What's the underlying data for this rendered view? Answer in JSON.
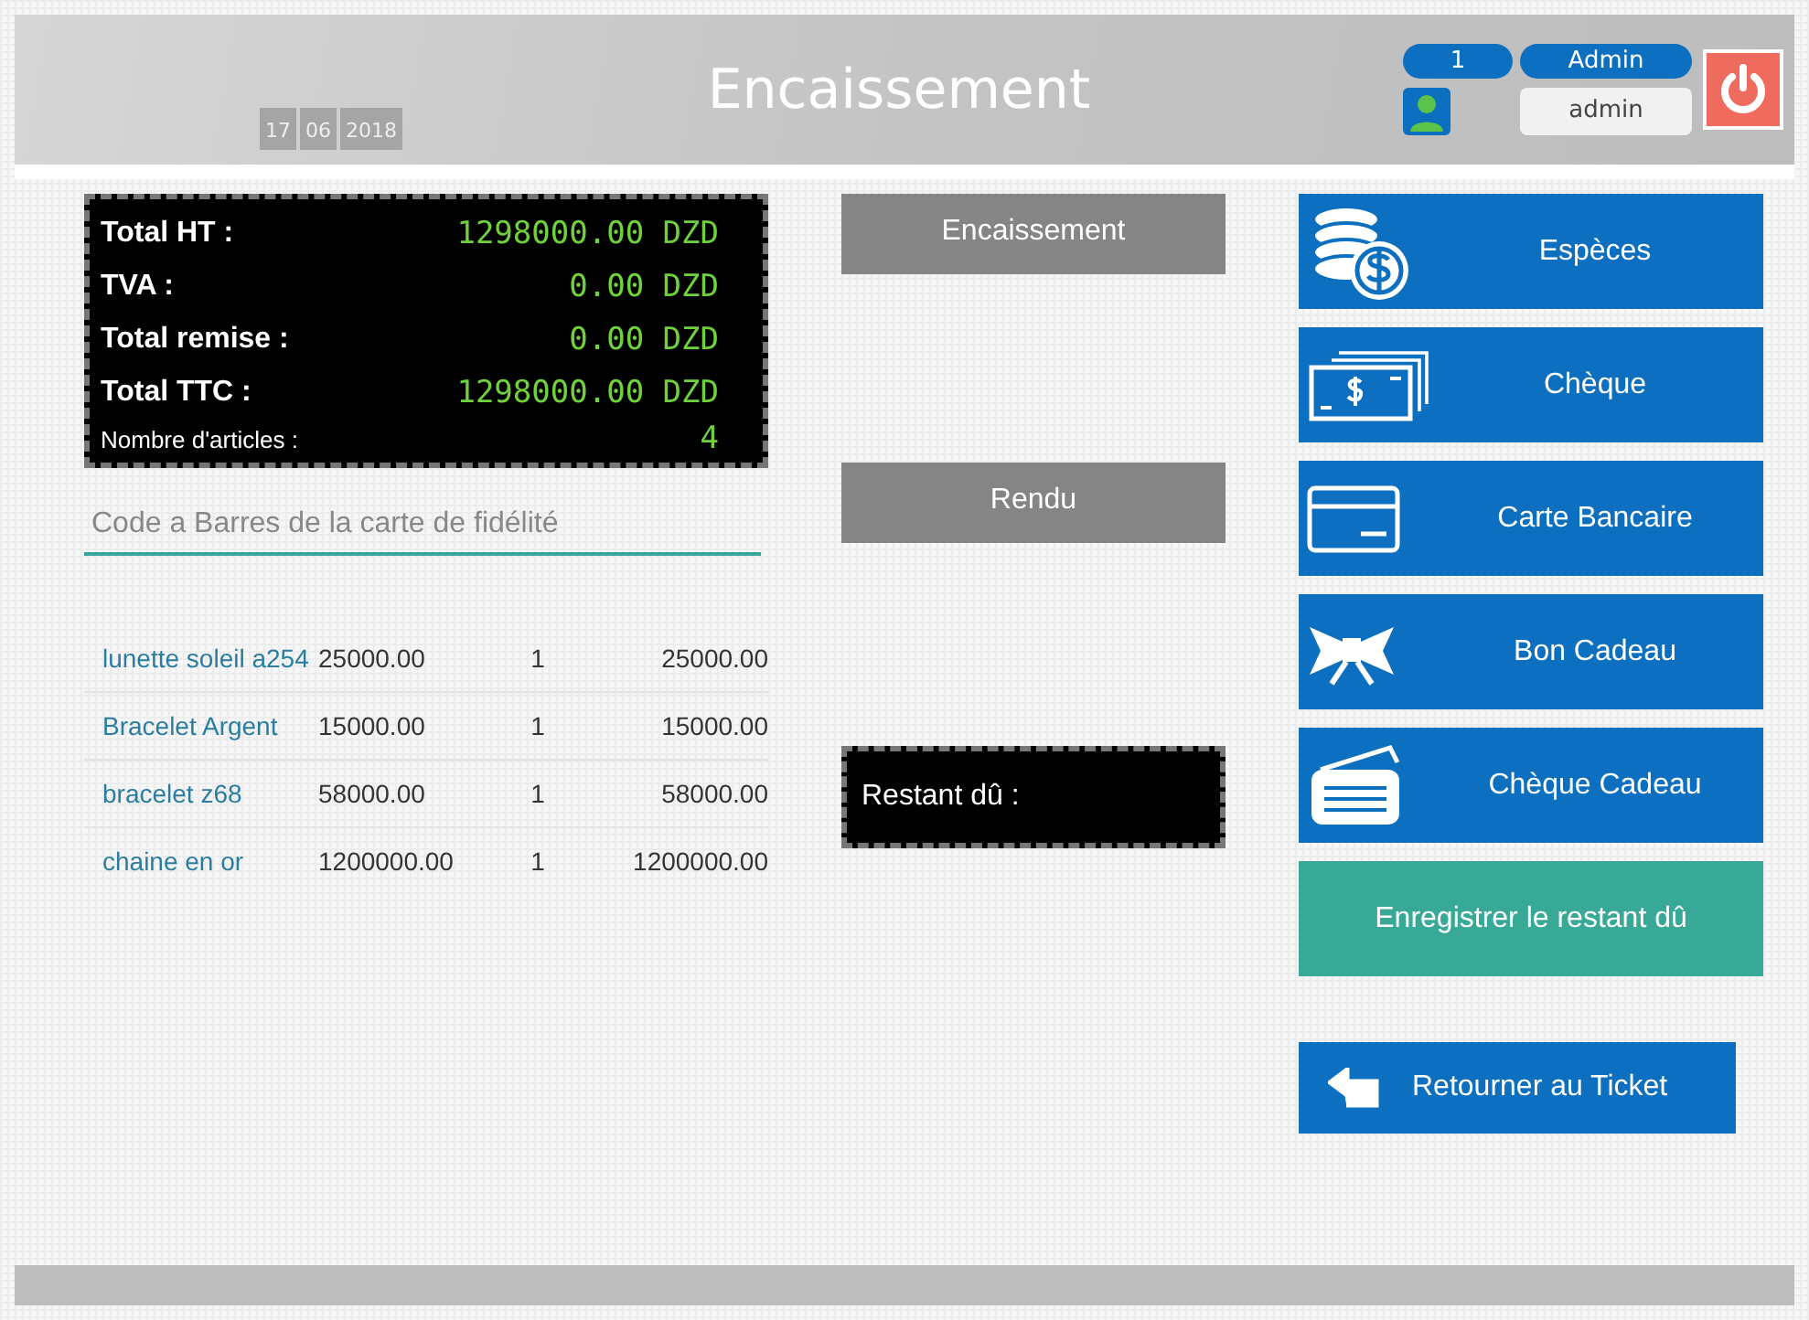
{
  "header": {
    "date": [
      "17",
      "06",
      "2018"
    ],
    "title": "Encaissement",
    "user": {
      "number": "1",
      "role": "Admin",
      "name": "admin"
    }
  },
  "totals": [
    {
      "label": "Total HT :",
      "value": "1298000.00 DZD",
      "kind": "major"
    },
    {
      "label": "TVA :",
      "value": "0.00 DZD",
      "kind": "major"
    },
    {
      "label": "Total remise :",
      "value": "0.00 DZD",
      "kind": "major"
    },
    {
      "label": "Total TTC :",
      "value": "1298000.00 DZD",
      "kind": "major"
    },
    {
      "label": "Nombre d'articles :",
      "value": "4",
      "kind": "minor"
    }
  ],
  "loyalty_field": {
    "placeholder": "Code a Barres de la carte de fidélité"
  },
  "items": [
    {
      "name": "lunette soleil a254",
      "price": "25000.00",
      "qty": "1",
      "total": "25000.00"
    },
    {
      "name": "Bracelet Argent",
      "price": "15000.00",
      "qty": "1",
      "total": "15000.00"
    },
    {
      "name": "bracelet z68",
      "price": "58000.00",
      "qty": "1",
      "total": "58000.00"
    },
    {
      "name": "chaine en or",
      "price": "1200000.00",
      "qty": "1",
      "total": "1200000.00"
    }
  ],
  "actions": [
    "Encaissement",
    "Rendu"
  ],
  "remaining": {
    "label": "Restant dû :"
  },
  "payment_methods": [
    {
      "label": "Espèces",
      "kind": "coins"
    },
    {
      "label": "Chèque",
      "kind": "bills"
    },
    {
      "label": "Carte Bancaire",
      "kind": "card"
    },
    {
      "label": "Bon Cadeau",
      "kind": "bow"
    },
    {
      "label": "Chèque Cadeau",
      "kind": "ticket"
    }
  ],
  "save_remaining_button": "Enregistrer le restant dû",
  "back_button": "Retourner au Ticket"
}
